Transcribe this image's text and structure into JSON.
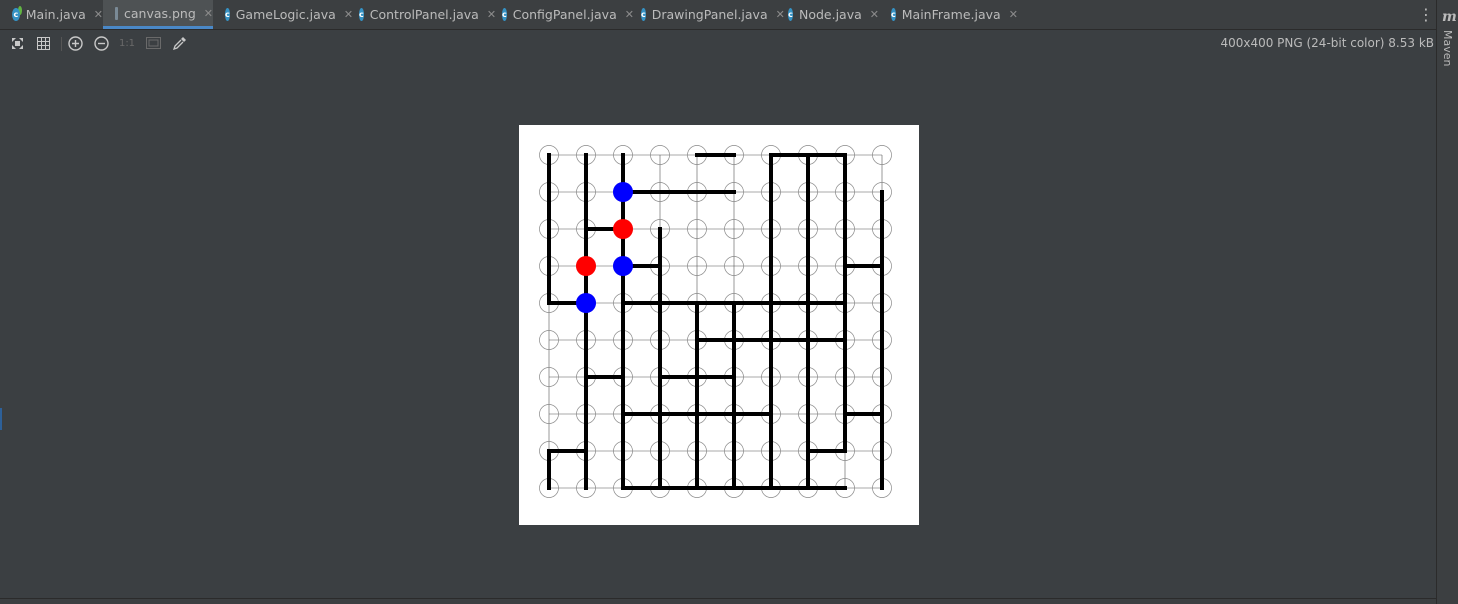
{
  "tabs": [
    {
      "label": "Main.java",
      "icon": "java-class-main-icon",
      "active": false
    },
    {
      "label": "canvas.png",
      "icon": "image-file-icon",
      "active": true
    },
    {
      "label": "GameLogic.java",
      "icon": "java-class-icon",
      "active": false
    },
    {
      "label": "ControlPanel.java",
      "icon": "java-class-icon",
      "active": false
    },
    {
      "label": "ConfigPanel.java",
      "icon": "java-class-icon",
      "active": false
    },
    {
      "label": "DrawingPanel.java",
      "icon": "java-class-icon",
      "active": false
    },
    {
      "label": "Node.java",
      "icon": "java-class-icon",
      "active": false
    },
    {
      "label": "MainFrame.java",
      "icon": "java-class-icon",
      "active": false
    }
  ],
  "toolbar": {
    "icons": [
      "fit-screen-icon",
      "grid-icon",
      "zoom-in-icon",
      "zoom-out-icon",
      "actual-size-icon",
      "background-icon",
      "color-picker-icon"
    ],
    "actual_size_label": "1:1"
  },
  "image_info": "400x400 PNG (24-bit color) 8.53 kB",
  "side_panel": {
    "logo": "m",
    "label": "Maven"
  },
  "colors": {
    "accent": "#4a88c7",
    "red_stone": "#ff0000",
    "blue_stone": "#0000ff"
  },
  "board": {
    "rows": 10,
    "cols": 10,
    "stones": [
      {
        "row": 1,
        "col": 2,
        "color": "blue"
      },
      {
        "row": 2,
        "col": 2,
        "color": "red"
      },
      {
        "row": 3,
        "col": 1,
        "color": "red"
      },
      {
        "row": 3,
        "col": 2,
        "color": "blue"
      },
      {
        "row": 4,
        "col": 1,
        "color": "blue"
      }
    ],
    "sticks_vertical": [
      [
        0,
        0,
        1
      ],
      [
        0,
        1,
        2
      ],
      [
        0,
        2,
        3
      ],
      [
        0,
        3,
        4
      ],
      [
        0,
        4,
        5
      ],
      [
        0,
        5,
        6
      ],
      [
        0,
        6,
        7
      ],
      [
        0,
        7,
        8
      ],
      [
        0,
        8,
        9
      ],
      [
        1,
        0,
        1
      ],
      [
        1,
        1,
        2
      ],
      [
        1,
        2,
        3
      ],
      [
        1,
        3,
        4
      ],
      [
        1,
        4,
        5
      ],
      [
        1,
        5,
        6
      ],
      [
        1,
        6,
        7
      ],
      [
        1,
        7,
        8
      ],
      [
        1,
        8,
        9
      ],
      [
        2,
        0,
        1
      ],
      [
        2,
        1,
        2
      ],
      [
        2,
        2,
        3
      ],
      [
        2,
        3,
        4
      ],
      [
        2,
        4,
        5
      ],
      [
        2,
        5,
        6
      ],
      [
        2,
        6,
        7
      ],
      [
        2,
        7,
        8
      ],
      [
        2,
        8,
        9
      ],
      [
        3,
        0,
        1
      ],
      [
        3,
        1,
        2
      ],
      [
        3,
        2,
        3
      ],
      [
        3,
        3,
        4
      ],
      [
        3,
        4,
        5
      ],
      [
        3,
        5,
        6
      ],
      [
        3,
        6,
        7
      ],
      [
        3,
        7,
        8
      ],
      [
        3,
        8,
        9
      ],
      [
        4,
        0,
        1
      ],
      [
        4,
        1,
        2
      ],
      [
        4,
        2,
        3
      ],
      [
        4,
        3,
        4
      ],
      [
        4,
        4,
        5
      ],
      [
        4,
        5,
        6
      ],
      [
        4,
        6,
        7
      ],
      [
        4,
        7,
        8
      ],
      [
        4,
        8,
        9
      ],
      [
        5,
        0,
        1
      ],
      [
        5,
        1,
        2
      ],
      [
        5,
        2,
        3
      ],
      [
        5,
        3,
        4
      ],
      [
        5,
        4,
        5
      ],
      [
        5,
        5,
        6
      ],
      [
        5,
        6,
        7
      ],
      [
        5,
        7,
        8
      ],
      [
        5,
        8,
        9
      ],
      [
        6,
        0,
        1
      ],
      [
        6,
        1,
        2
      ],
      [
        6,
        2,
        3
      ],
      [
        6,
        3,
        4
      ],
      [
        6,
        4,
        5
      ],
      [
        6,
        5,
        6
      ],
      [
        6,
        6,
        7
      ],
      [
        6,
        7,
        8
      ],
      [
        6,
        8,
        9
      ],
      [
        7,
        0,
        1
      ],
      [
        7,
        1,
        2
      ],
      [
        7,
        2,
        3
      ],
      [
        7,
        3,
        4
      ],
      [
        7,
        4,
        5
      ],
      [
        7,
        5,
        6
      ],
      [
        7,
        6,
        7
      ],
      [
        7,
        7,
        8
      ],
      [
        7,
        8,
        9
      ],
      [
        8,
        0,
        1
      ],
      [
        8,
        1,
        2
      ],
      [
        8,
        2,
        3
      ],
      [
        8,
        3,
        4
      ],
      [
        8,
        4,
        5
      ],
      [
        8,
        5,
        6
      ],
      [
        8,
        6,
        7
      ],
      [
        8,
        7,
        8
      ],
      [
        8,
        8,
        9
      ],
      [
        9,
        0,
        1
      ],
      [
        9,
        1,
        2
      ],
      [
        9,
        2,
        3
      ],
      [
        9,
        3,
        4
      ],
      [
        9,
        4,
        5
      ],
      [
        9,
        5,
        6
      ],
      [
        9,
        6,
        7
      ],
      [
        9,
        7,
        8
      ],
      [
        9,
        8,
        9
      ]
    ],
    "sticks_horizontal": [
      [
        0,
        4,
        5
      ],
      [
        0,
        6,
        7
      ],
      [
        0,
        7,
        8
      ],
      [
        1,
        2,
        3
      ],
      [
        1,
        3,
        4
      ],
      [
        1,
        4,
        5
      ],
      [
        2,
        1,
        2
      ],
      [
        3,
        2,
        3
      ],
      [
        3,
        8,
        9
      ],
      [
        4,
        0,
        1
      ],
      [
        4,
        2,
        3
      ],
      [
        4,
        3,
        4
      ],
      [
        4,
        4,
        5
      ],
      [
        4,
        5,
        6
      ],
      [
        4,
        6,
        7
      ],
      [
        4,
        7,
        8
      ],
      [
        5,
        4,
        5
      ],
      [
        5,
        5,
        6
      ],
      [
        5,
        6,
        7
      ],
      [
        5,
        7,
        8
      ],
      [
        6,
        1,
        2
      ],
      [
        6,
        3,
        4
      ],
      [
        6,
        4,
        5
      ],
      [
        7,
        2,
        3
      ],
      [
        7,
        3,
        4
      ],
      [
        7,
        4,
        5
      ],
      [
        7,
        5,
        6
      ],
      [
        7,
        8,
        9
      ],
      [
        8,
        0,
        1
      ],
      [
        8,
        7,
        8
      ],
      [
        9,
        2,
        3
      ],
      [
        9,
        3,
        4
      ],
      [
        9,
        4,
        5
      ],
      [
        9,
        5,
        6
      ],
      [
        9,
        6,
        7
      ],
      [
        9,
        7,
        8
      ]
    ],
    "missing_vertical": [
      [
        0,
        4,
        5
      ],
      [
        0,
        5,
        6
      ],
      [
        0,
        6,
        7
      ],
      [
        0,
        7,
        8
      ],
      [
        3,
        0,
        1
      ],
      [
        3,
        1,
        2
      ],
      [
        4,
        0,
        1
      ],
      [
        4,
        1,
        2
      ],
      [
        4,
        2,
        3
      ],
      [
        4,
        3,
        4
      ],
      [
        5,
        0,
        1
      ],
      [
        5,
        1,
        2
      ],
      [
        5,
        2,
        3
      ],
      [
        5,
        3,
        4
      ],
      [
        8,
        8,
        9
      ],
      [
        9,
        0,
        1
      ]
    ]
  }
}
